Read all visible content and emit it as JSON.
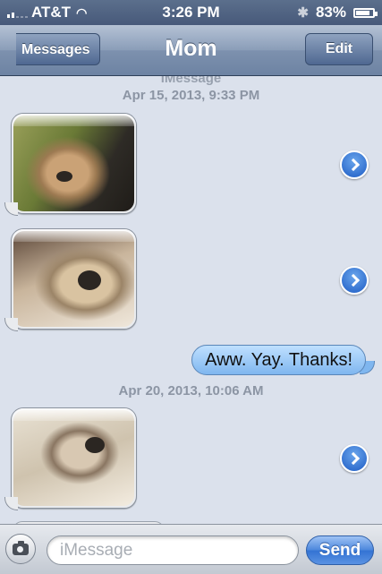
{
  "status_bar": {
    "carrier": "AT&T",
    "time": "3:26 PM",
    "battery": "83%",
    "battery_level": 0.83
  },
  "nav": {
    "back_label": "Messages",
    "title": "Mom",
    "edit_label": "Edit"
  },
  "conversation": {
    "partial_label": "iMessage",
    "timestamps": [
      "Apr 15, 2013, 9:33 PM",
      "Apr 20, 2013, 10:06 AM"
    ],
    "messages": [
      {
        "type": "photo",
        "direction": "received"
      },
      {
        "type": "photo",
        "direction": "received"
      },
      {
        "type": "text",
        "direction": "sent",
        "text": "Aww. Yay. Thanks!"
      },
      {
        "type": "photo",
        "direction": "received"
      }
    ]
  },
  "input_bar": {
    "placeholder": "iMessage",
    "value": "",
    "send_label": "Send"
  },
  "colors": {
    "sent_bubble": "#7fb6ef",
    "nav_bar": "#6d83a3",
    "background": "#dbe1ec"
  },
  "icons": [
    "wifi-icon",
    "bluetooth-icon",
    "battery-icon",
    "forward-arrow-icon",
    "camera-icon"
  ]
}
